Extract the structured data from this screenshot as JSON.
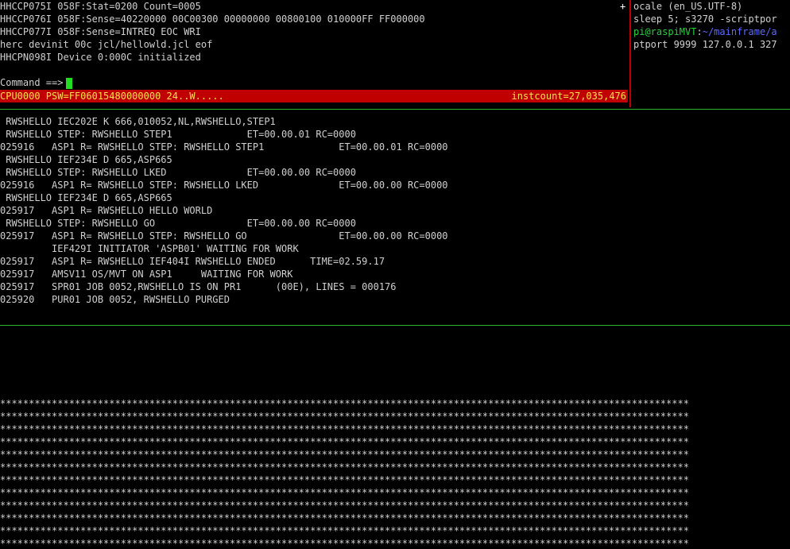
{
  "hercules": {
    "lines": [
      "HHCCP075I 058F:Stat=0200 Count=0005",
      "HHCCP076I 058F:Sense=40220000 00C00300 00000000 00800100 010000FF FF000000",
      "HHCCP077I 058F:Sense=INTREQ EOC WRI",
      "herc devinit 00c jcl/hellowld.jcl eof",
      "HHCPN098I Device 0:000C initialized"
    ],
    "command_prompt": "Command ==>",
    "scroll_marker": "+",
    "status_left": "CPU0000 PSW=FF06015480000000 24..W.....",
    "status_right": "instcount=27,035,476"
  },
  "right_pane": {
    "line1": "ocale (en_US.UTF-8)",
    "line2": "sleep 5; s3270 -scriptpor",
    "prompt_user": "pi@raspiMVT",
    "prompt_sep": ":",
    "prompt_path": "~/mainframe/a",
    "line4": "ptport 9999 127.0.0.1 327"
  },
  "console_lines": [
    " RWSHELLO IEC202E K 666,010052,NL,RWSHELLO,STEP1",
    " RWSHELLO STEP: RWSHELLO STEP1             ET=00.00.01 RC=0000",
    "025916   ASP1 R= RWSHELLO STEP: RWSHELLO STEP1             ET=00.00.01 RC=0000",
    " RWSHELLO IEF234E D 665,ASP665",
    " RWSHELLO STEP: RWSHELLO LKED              ET=00.00.00 RC=0000",
    "025916   ASP1 R= RWSHELLO STEP: RWSHELLO LKED              ET=00.00.00 RC=0000",
    " RWSHELLO IEF234E D 665,ASP665",
    "025917   ASP1 R= RWSHELLO HELLO WORLD",
    " RWSHELLO STEP: RWSHELLO GO                ET=00.00.00 RC=0000",
    "025917   ASP1 R= RWSHELLO STEP: RWSHELLO GO                ET=00.00.00 RC=0000",
    "         IEF429I INITIATOR 'ASPB01' WAITING FOR WORK",
    "025917   ASP1 R= RWSHELLO IEF404I RWSHELLO ENDED      TIME=02.59.17",
    "025917   AMSV11 OS/MVT ON ASP1     WAITING FOR WORK",
    "025917   SPR01 JOB 0052,RWSHELLO IS ON PR1      (00E), LINES = 000176",
    "025920   PUR01 JOB 0052, RWSHELLO PURGED"
  ],
  "stars_line": "************************************************************************************************************************"
}
